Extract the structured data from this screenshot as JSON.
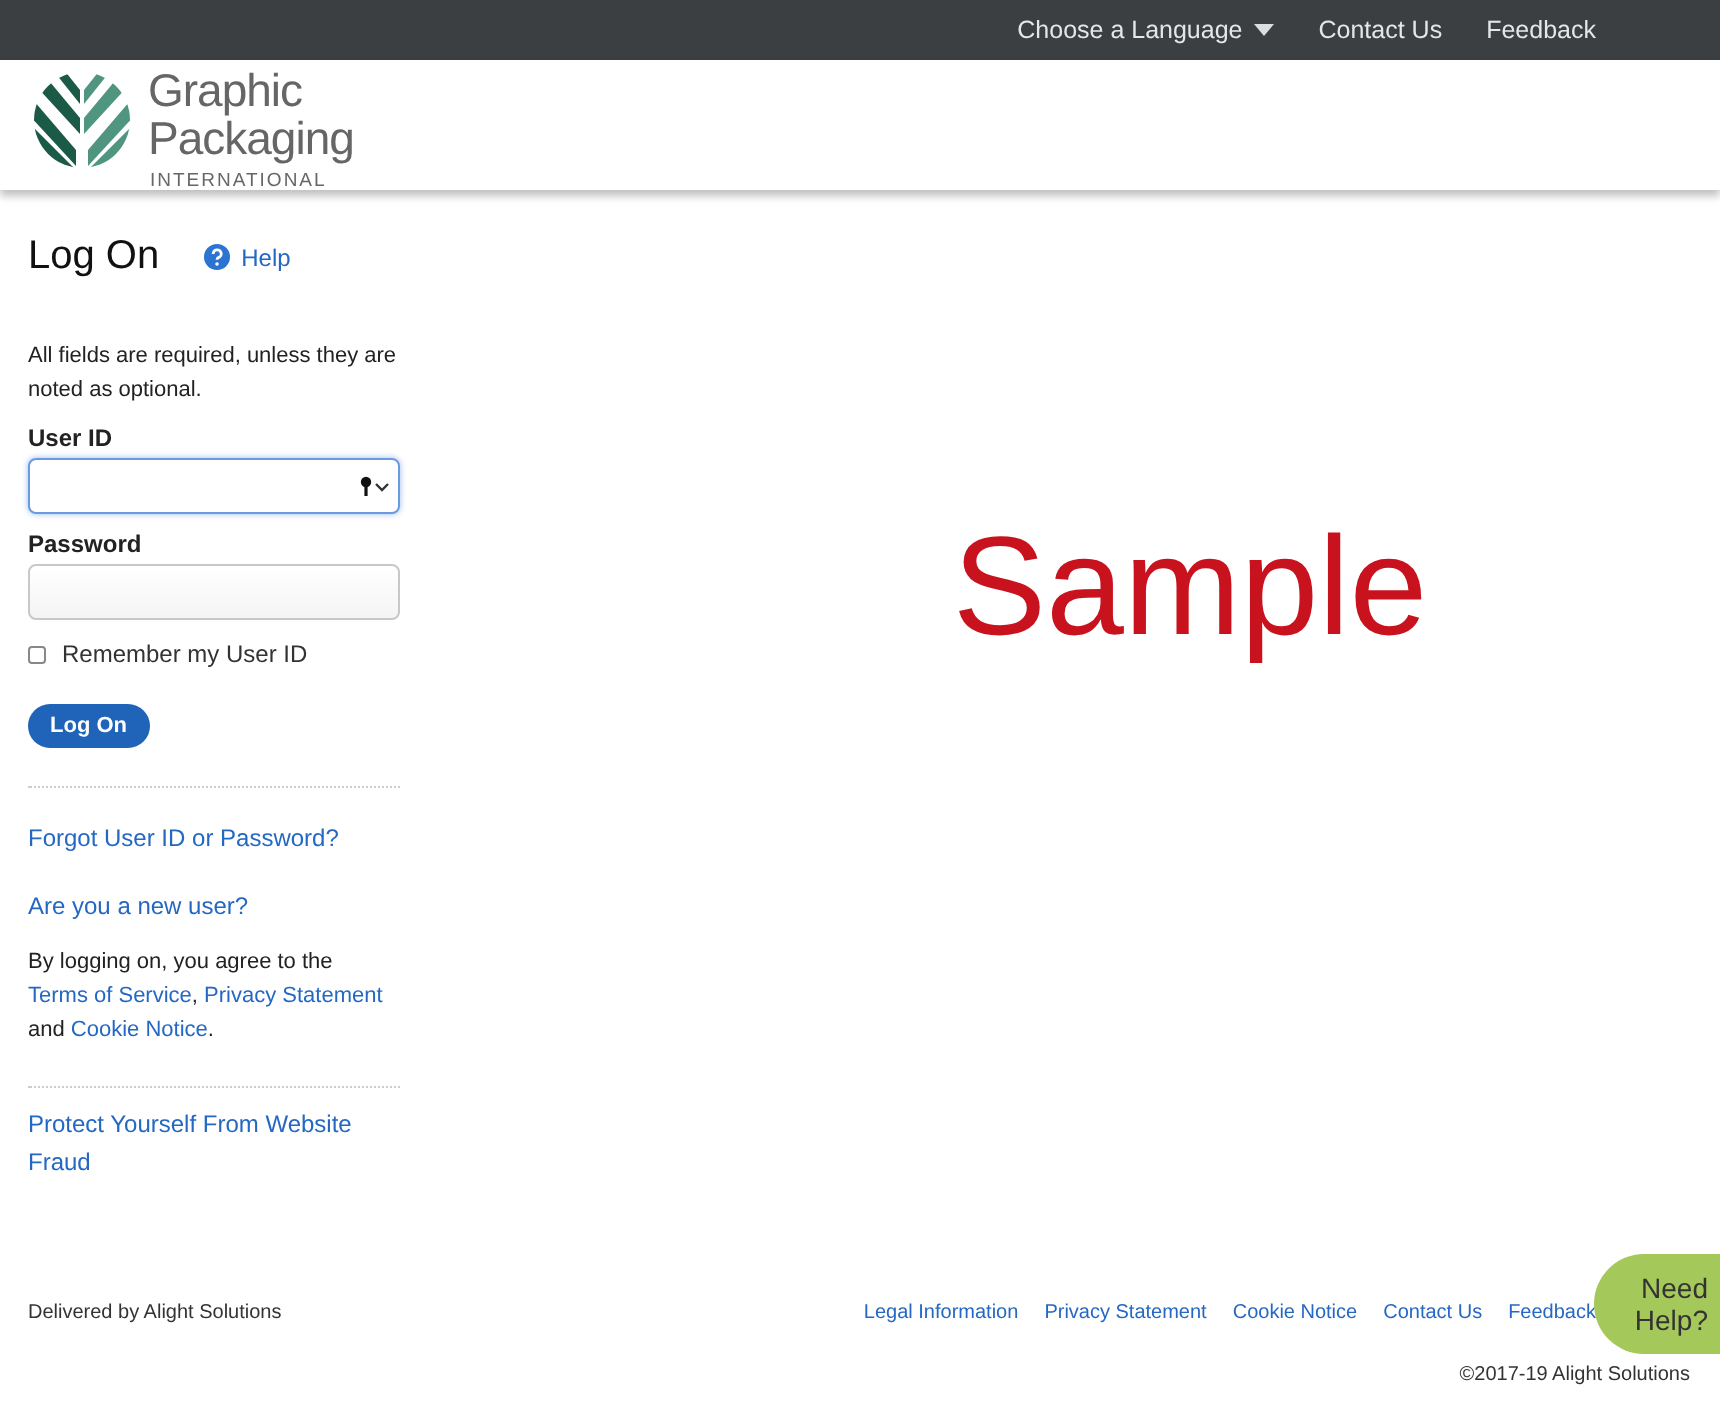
{
  "top_nav": {
    "language_menu": "Choose a Language",
    "links": [
      "Contact Us",
      "Feedback"
    ]
  },
  "logo": {
    "line_1": "Graphic",
    "line_2": "Packaging",
    "tagline": "INTERNATIONAL"
  },
  "login": {
    "title": "Log On",
    "help": "Help",
    "required_note": "All fields are required, unless they are noted as optional.",
    "fields": [
      {
        "label": "User ID",
        "kind": "text",
        "focused": true
      },
      {
        "label": "Password",
        "kind": "password",
        "focused": false
      }
    ],
    "remember": {
      "label": "Remember my User ID",
      "checked": false
    },
    "submit": "Log On",
    "links": [
      "Forgot User ID or Password?",
      "Are you a new user?"
    ],
    "agreement": [
      {
        "kind": "text",
        "text": "By logging on, you agree to the "
      },
      {
        "kind": "link",
        "text": "Terms of Service"
      },
      {
        "kind": "text",
        "text": ", "
      },
      {
        "kind": "link",
        "text": "Privacy Statement"
      },
      {
        "kind": "text",
        "text": " and "
      },
      {
        "kind": "link",
        "text": "Cookie Notice"
      },
      {
        "kind": "text",
        "text": "."
      }
    ],
    "fraud_link": "Protect Yourself From Website Fraud"
  },
  "sample_text": "Sample",
  "footer": {
    "delivered_by": "Delivered by Alight Solutions",
    "links": [
      "Legal Information",
      "Privacy Statement",
      "Cookie Notice",
      "Contact Us",
      "Feedback"
    ],
    "copyright": "©2017-19 Alight Solutions"
  },
  "need_help": "Need Help?"
}
